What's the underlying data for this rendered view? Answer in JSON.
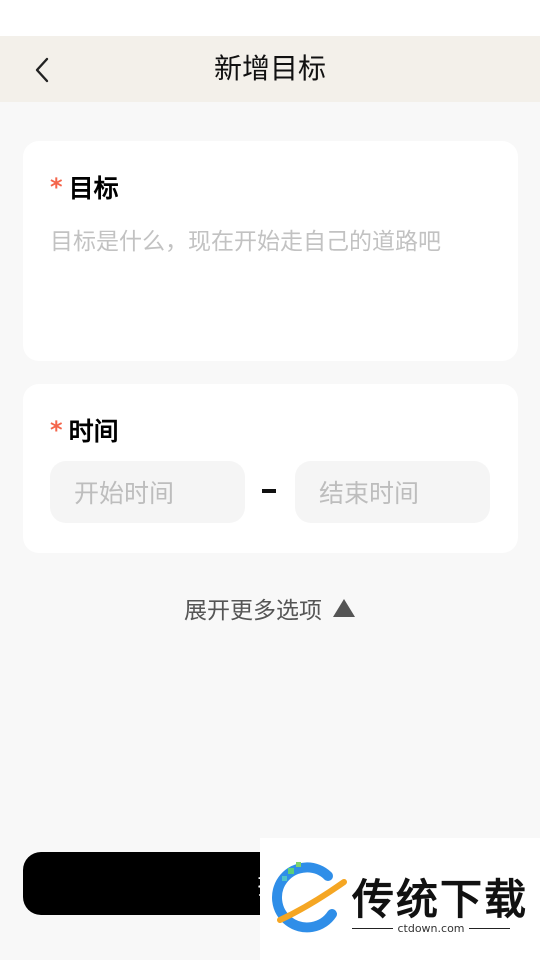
{
  "header": {
    "title": "新增目标",
    "back_icon": "chevron-left-icon"
  },
  "goal": {
    "label": "目标",
    "required_mark": "*",
    "placeholder": "目标是什么，现在开始走自己的道路吧"
  },
  "time": {
    "label": "时间",
    "required_mark": "*",
    "start_placeholder": "开始时间",
    "separator": "-",
    "end_placeholder": "结束时间"
  },
  "more_options": {
    "label": "展开更多选项",
    "icon": "triangle-up-icon"
  },
  "submit": {
    "label": "提"
  },
  "watermark": {
    "text": "传统下载",
    "subtext": "ctdown.com"
  },
  "colors": {
    "accent_required": "#f4654b",
    "nav_background": "#f3f0ea",
    "page_background": "#f8f8f8",
    "button_background": "#000000"
  }
}
